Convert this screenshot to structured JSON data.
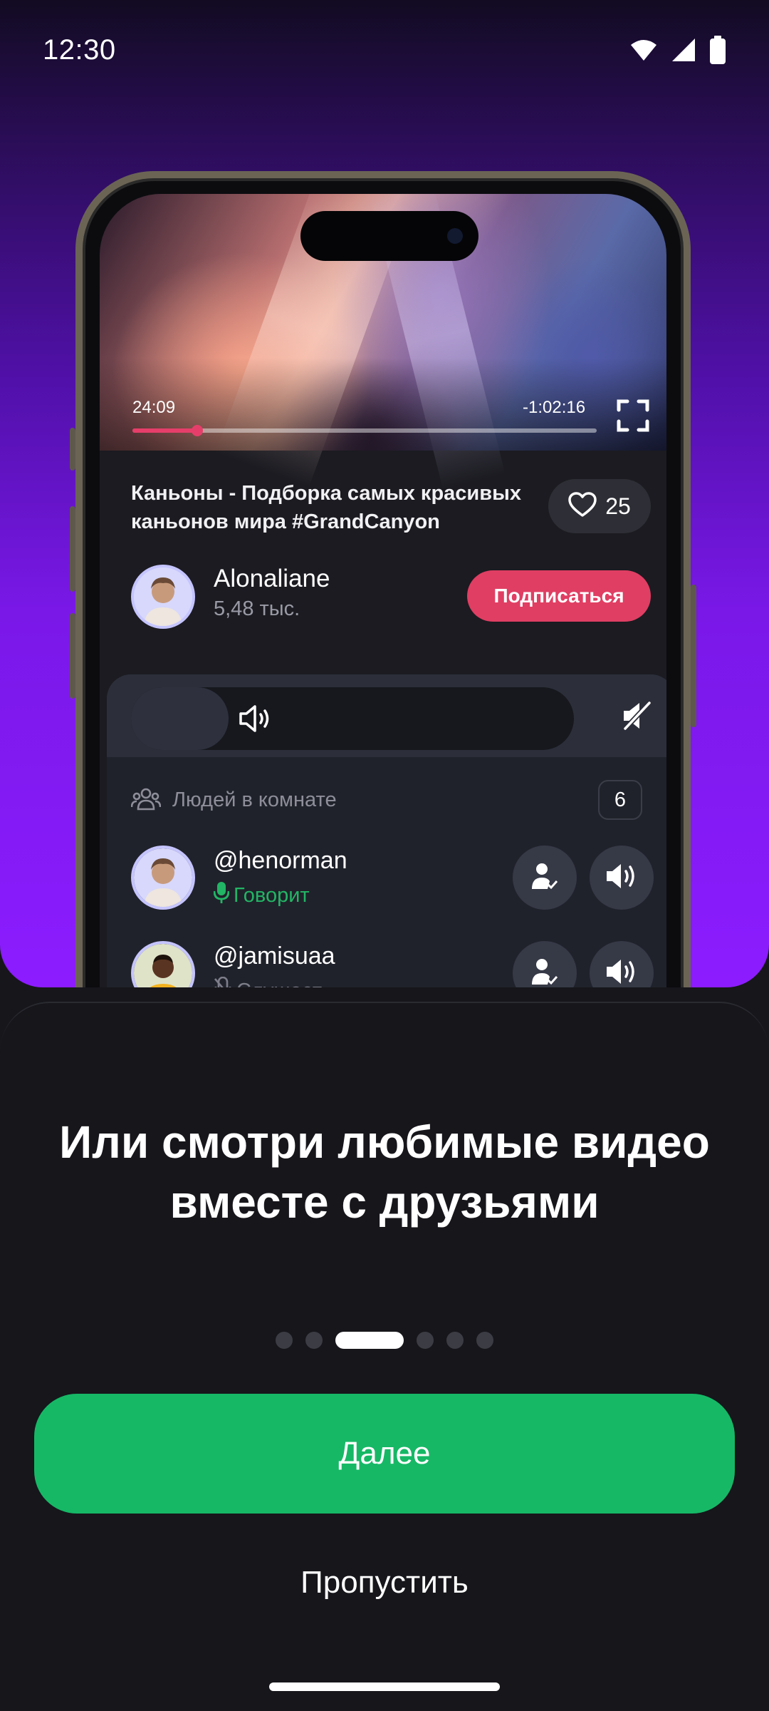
{
  "status_bar": {
    "time": "12:30",
    "icons": [
      "wifi-icon",
      "signal-icon",
      "battery-icon"
    ]
  },
  "mockup": {
    "video": {
      "current_time": "24:09",
      "remaining_time": "-1:02:16",
      "progress": 0.14,
      "icons": [
        "fullscreen-icon"
      ]
    },
    "title": "Каньоны - Подборка самых красивых каньонов мира #GrandCanyon",
    "likes": "25",
    "channel": {
      "name": "Alonaliane",
      "subscribers": "5,48 тыс.",
      "subscribe_label": "Подписаться"
    },
    "room": {
      "volume_level": 0.22,
      "people_label": "Людей в комнате",
      "people_count": "6",
      "members": [
        {
          "handle": "@henorman",
          "status": "Говорит",
          "status_icon": "mic-icon"
        },
        {
          "handle": "@jamisuaa",
          "status": "Слушает",
          "status_icon": "mic-off-icon"
        }
      ]
    }
  },
  "onboarding": {
    "headline_line1": "Или смотри любимые видео",
    "headline_line2": "вместе с друзьями",
    "page_count": 6,
    "active_page": 2,
    "next_label": "Далее",
    "skip_label": "Пропустить"
  },
  "colors": {
    "accent_green": "#16b866",
    "subscribe_red": "#e03e63",
    "speaking_green": "#22b565",
    "hero_purple": "#8c1cff"
  }
}
